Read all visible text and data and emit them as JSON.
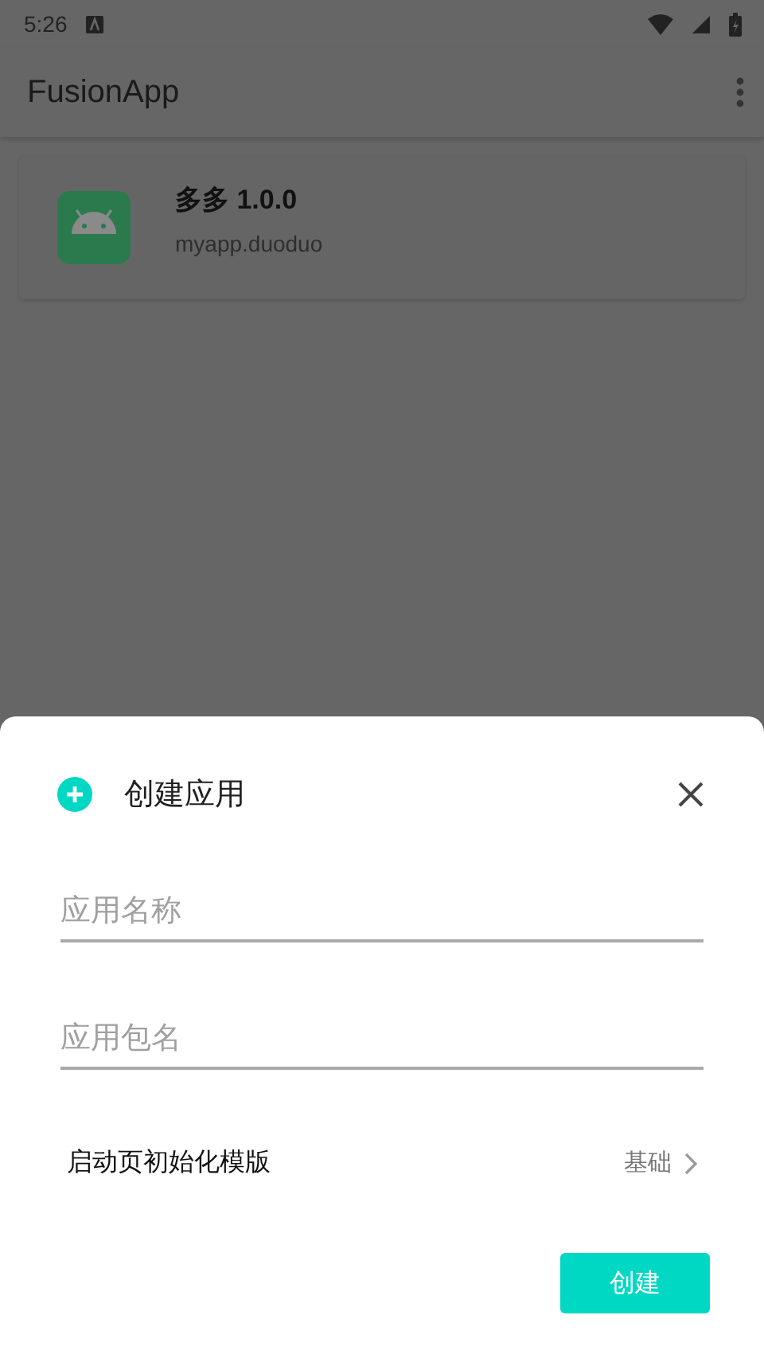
{
  "status_bar": {
    "time": "5:26"
  },
  "app_bar": {
    "title": "FusionApp"
  },
  "apps": [
    {
      "name": "多多 1.0.0",
      "package": "myapp.duoduo"
    }
  ],
  "dialog": {
    "title": "创建应用",
    "fields": [
      {
        "placeholder": "应用名称"
      },
      {
        "placeholder": "应用包名"
      }
    ],
    "template": {
      "label": "启动页初始化模版",
      "value": "基础"
    },
    "button": "创建"
  }
}
